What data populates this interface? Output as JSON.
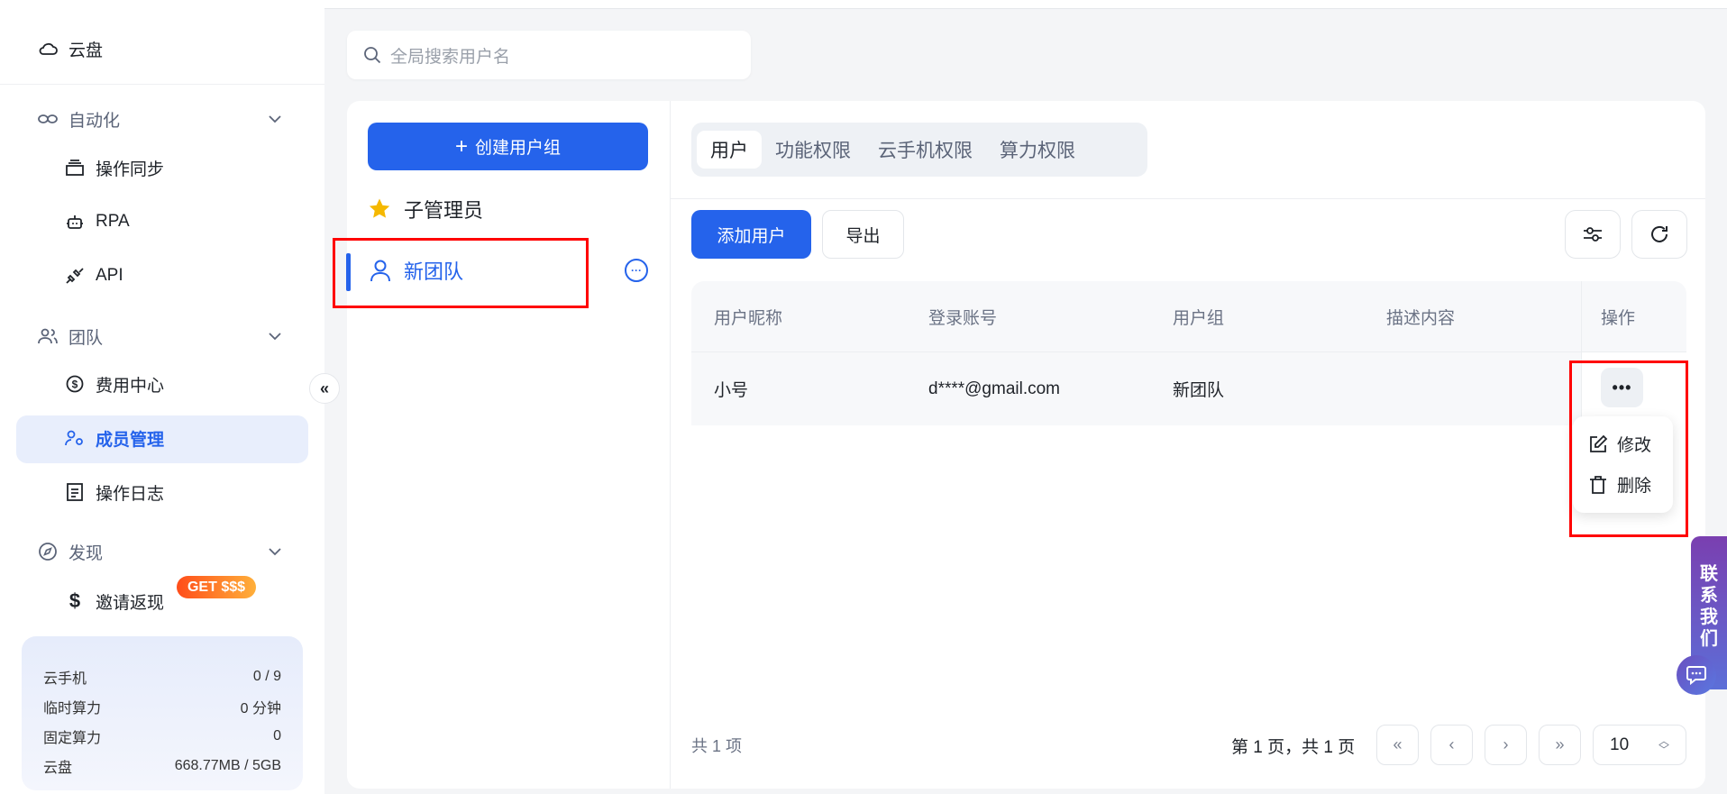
{
  "sidebar": {
    "cloud_disk": "云盘",
    "automation": {
      "label": "自动化",
      "items": [
        "操作同步",
        "RPA",
        "API"
      ]
    },
    "team": {
      "label": "团队",
      "items": [
        "费用中心",
        "成员管理",
        "操作日志"
      ]
    },
    "discover": {
      "label": "发现",
      "items": [
        "邀请返现"
      ],
      "badge": "GET $$$"
    },
    "stats": [
      {
        "label": "云手机",
        "value": "0 / 9"
      },
      {
        "label": "临时算力",
        "value": "0 分钟"
      },
      {
        "label": "固定算力",
        "value": "0"
      },
      {
        "label": "云盘",
        "value": "668.77MB / 5GB"
      }
    ]
  },
  "search": {
    "placeholder": "全局搜索用户名"
  },
  "groups": {
    "create_label": "创建用户组",
    "items": [
      {
        "name": "子管理员",
        "icon": "star-icon"
      },
      {
        "name": "新团队",
        "icon": "user-icon"
      }
    ]
  },
  "tabs": [
    "用户",
    "功能权限",
    "云手机权限",
    "算力权限"
  ],
  "toolbar": {
    "add_user": "添加用户",
    "export": "导出"
  },
  "table": {
    "columns": [
      "用户昵称",
      "登录账号",
      "用户组",
      "描述内容",
      "操作"
    ],
    "rows": [
      {
        "nickname": "小号",
        "account": "d****@gmail.com",
        "group": "新团队",
        "description": ""
      }
    ]
  },
  "row_menu": {
    "edit": "修改",
    "delete": "删除"
  },
  "footer": {
    "total": "共 1 项",
    "page_info": "第 1 页，共 1 页",
    "page_size": "10"
  },
  "contact": {
    "chars": [
      "联",
      "系",
      "我",
      "们"
    ]
  },
  "colors": {
    "accent": "#2563eb",
    "highlight": "#ff0000"
  }
}
